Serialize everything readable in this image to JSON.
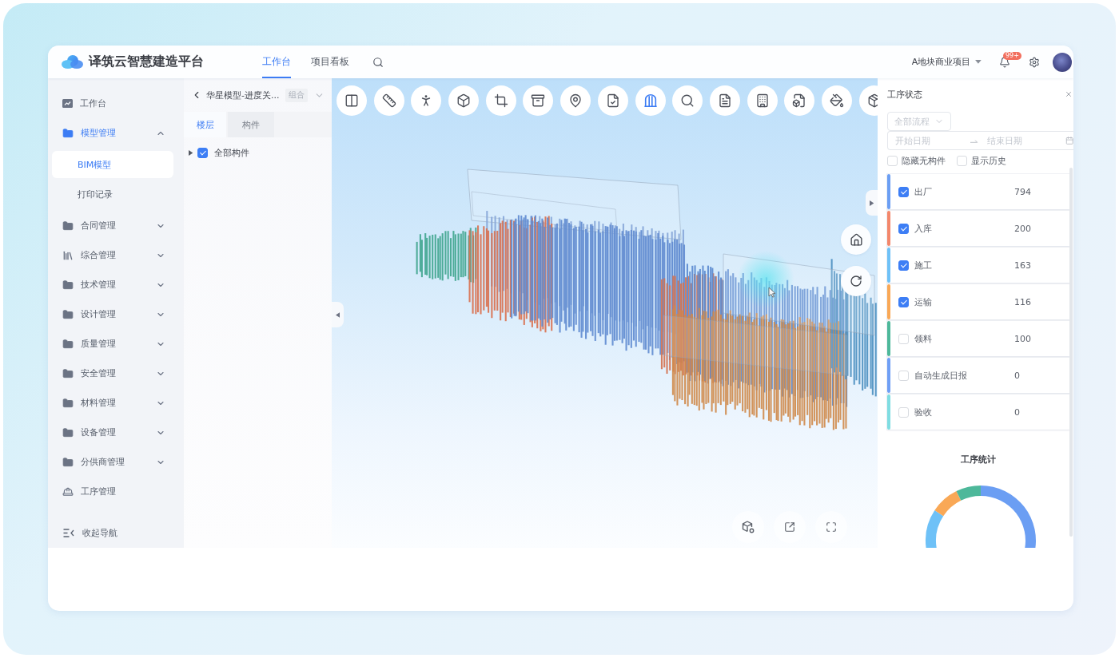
{
  "header": {
    "brand": "译筑云智慧建造平台",
    "nav": [
      {
        "label": "工作台",
        "selected": true
      },
      {
        "label": "项目看板",
        "selected": false
      }
    ],
    "project": "A地块商业项目",
    "notification_badge": "99+"
  },
  "sidebar": {
    "items": [
      {
        "label": "工作台",
        "kind": "dashboard",
        "selected": false
      },
      {
        "label": "模型管理",
        "kind": "folder",
        "selected": true,
        "expanded": true,
        "children": [
          {
            "label": "BIM模型",
            "selected": true
          },
          {
            "label": "打印记录",
            "selected": false
          }
        ]
      },
      {
        "label": "合同管理",
        "kind": "folder",
        "selected": false,
        "expanded": false
      },
      {
        "label": "综合管理",
        "kind": "library",
        "selected": false,
        "expanded": false
      },
      {
        "label": "技术管理",
        "kind": "folder",
        "selected": false,
        "expanded": false
      },
      {
        "label": "设计管理",
        "kind": "folder",
        "selected": false,
        "expanded": false
      },
      {
        "label": "质量管理",
        "kind": "folder",
        "selected": false,
        "expanded": false
      },
      {
        "label": "安全管理",
        "kind": "folder",
        "selected": false,
        "expanded": false
      },
      {
        "label": "材料管理",
        "kind": "folder",
        "selected": false,
        "expanded": false
      },
      {
        "label": "设备管理",
        "kind": "folder",
        "selected": false,
        "expanded": false
      },
      {
        "label": "分供商管理",
        "kind": "folder",
        "selected": false,
        "expanded": false
      },
      {
        "label": "工序管理",
        "kind": "worker",
        "selected": false
      }
    ],
    "collapse_label": "收起导航"
  },
  "model_panel": {
    "title": "华星模型-进度关...",
    "tag": "组合",
    "tabs": [
      {
        "label": "楼层",
        "selected": true
      },
      {
        "label": "构件",
        "selected": false
      }
    ],
    "tree": [
      {
        "label": "全部构件",
        "checked": true,
        "expanded": false
      }
    ]
  },
  "viewer": {
    "tools": [
      {
        "kind": "section",
        "selected": false
      },
      {
        "kind": "measure",
        "selected": false
      },
      {
        "kind": "walk",
        "selected": false
      },
      {
        "kind": "cube",
        "selected": false
      },
      {
        "kind": "crop",
        "selected": false
      },
      {
        "kind": "archive",
        "selected": false
      },
      {
        "kind": "pin",
        "selected": false
      },
      {
        "kind": "doccheck",
        "selected": false
      },
      {
        "kind": "arch",
        "selected": true
      },
      {
        "kind": "search",
        "selected": false
      },
      {
        "kind": "doc",
        "selected": false
      },
      {
        "kind": "elevation",
        "selected": false
      },
      {
        "kind": "doccube",
        "selected": false
      },
      {
        "kind": "paint",
        "selected": false
      },
      {
        "kind": "package",
        "selected": false
      }
    ]
  },
  "status_panel": {
    "title": "工序状态",
    "process_select": {
      "placeholder": "全部流程"
    },
    "date_range": {
      "start_placeholder": "开始日期",
      "end_placeholder": "结束日期"
    },
    "filters": [
      {
        "label": "隐藏无构件",
        "checked": false
      },
      {
        "label": "显示历史",
        "checked": false
      }
    ],
    "statuses": [
      {
        "label": "出厂",
        "count": "794",
        "color": "#6b9ef3",
        "checked": true
      },
      {
        "label": "入库",
        "count": "200",
        "color": "#f3876b",
        "checked": true
      },
      {
        "label": "施工",
        "count": "163",
        "color": "#6ec1f7",
        "checked": true
      },
      {
        "label": "运输",
        "count": "116",
        "color": "#f9a856",
        "checked": true
      },
      {
        "label": "领料",
        "count": "100",
        "color": "#4db89a",
        "checked": false
      },
      {
        "label": "自动生成日报",
        "count": "0",
        "color": "#6f9ff5",
        "checked": false
      },
      {
        "label": "验收",
        "count": "0",
        "color": "#7fdde2",
        "checked": false
      }
    ],
    "stats": {
      "title": "工序统计"
    }
  }
}
